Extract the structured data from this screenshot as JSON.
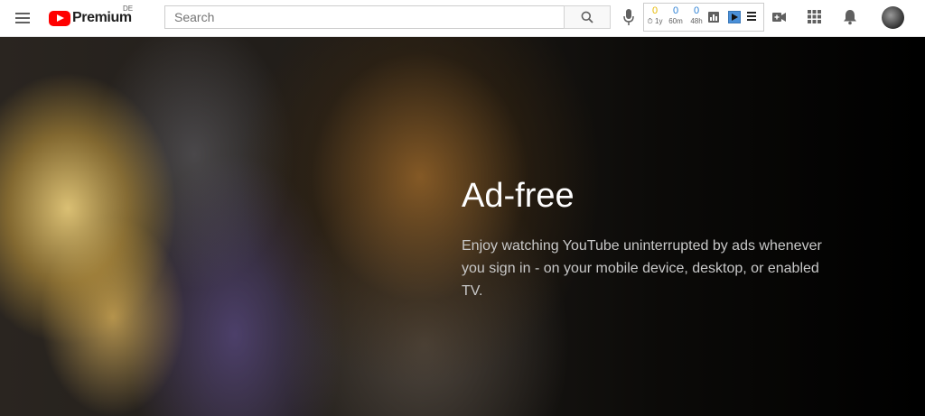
{
  "header": {
    "logo": {
      "text": "Premium",
      "region": "DE"
    },
    "search": {
      "placeholder": "Search"
    },
    "extension": {
      "stats": [
        {
          "value": "0",
          "label": "1y",
          "color": "#e6b800"
        },
        {
          "value": "0",
          "label": "60m",
          "color": "#2a7fd4"
        },
        {
          "value": "0",
          "label": "48h",
          "color": "#2a7fd4"
        }
      ]
    },
    "icons": [
      "menu-icon",
      "search-icon",
      "microphone-icon",
      "create-video-icon",
      "apps-grid-icon",
      "notifications-icon"
    ]
  },
  "hero": {
    "title": "Ad-free",
    "description": "Enjoy watching YouTube uninterrupted by ads whenever you sign in - on your mobile device, desktop, or enabled TV."
  },
  "colors": {
    "brand": "#ff0000",
    "text_dark": "#212121",
    "icon_gray": "#606060"
  }
}
